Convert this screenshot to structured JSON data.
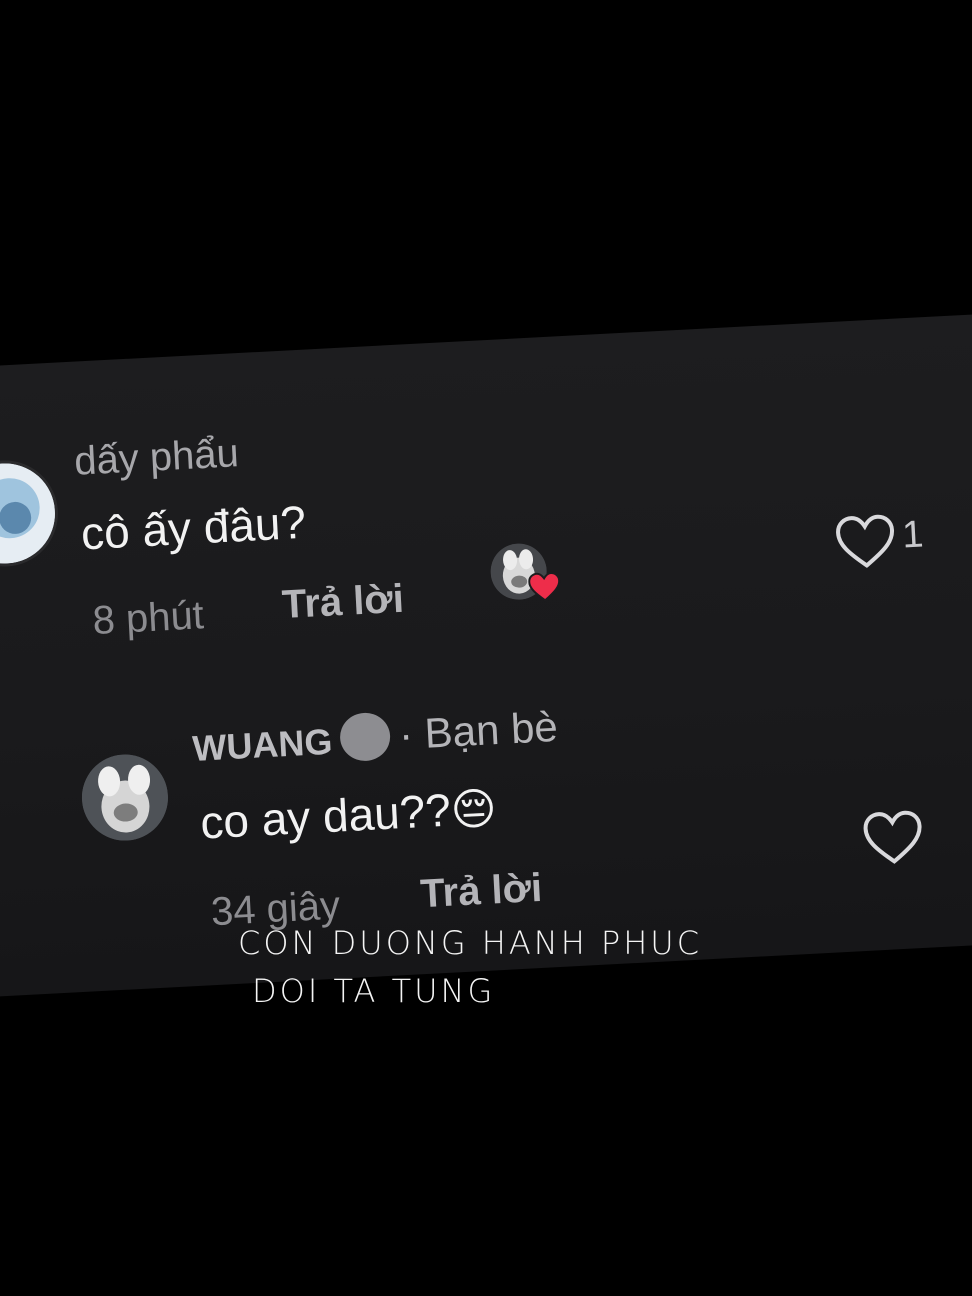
{
  "comments": [
    {
      "username": "dấy phẩu",
      "text": "cô ấy đâu?",
      "time": "8 phút",
      "reply_label": "Trả lời",
      "like_count": "1"
    },
    {
      "username": "WUANG",
      "friend_label": "· Bạn bè",
      "text": "co ay dau??",
      "emoji": "😔",
      "time": "34 giây",
      "reply_label": "Trả lời"
    }
  ],
  "caption": {
    "line1": "CON DUONG HANH PHUC",
    "line2": "DOI TA TUNG"
  },
  "colors": {
    "background": "#000000",
    "panel": "#1c1c1e",
    "heart_badge": "#ee2d4a"
  }
}
